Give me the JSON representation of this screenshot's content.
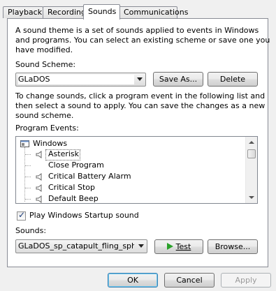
{
  "tabs": [
    {
      "label": "Playback"
    },
    {
      "label": "Recording"
    },
    {
      "label": "Sounds",
      "active": true
    },
    {
      "label": "Communications"
    }
  ],
  "intro_text": [
    "A sound theme is a set of sounds applied to events in Windows",
    "and programs.  You can select an existing scheme or save one you",
    "have modified."
  ],
  "scheme": {
    "label": "Sound Scheme:",
    "value": "GLaDOS",
    "save_as_label": "Save As...",
    "delete_label": "Delete"
  },
  "change_text": [
    "To change sounds, click a program event in the following list and",
    "then select a sound to apply.  You can save the changes as a new",
    "sound scheme."
  ],
  "events": {
    "label": "Program Events:",
    "group": "Windows",
    "items": [
      {
        "label": "Asterisk",
        "selected": true
      },
      {
        "label": "Close Program"
      },
      {
        "label": "Critical Battery Alarm"
      },
      {
        "label": "Critical Stop"
      },
      {
        "label": "Default Beep"
      }
    ]
  },
  "startup": {
    "label": "Play Windows Startup sound",
    "checked": true
  },
  "sounds": {
    "label": "Sounds:",
    "value": "GLaDOS_sp_catapult_fling_sphe",
    "test_label": "Test",
    "browse_label": "Browse..."
  },
  "footer": {
    "ok_label": "OK",
    "cancel_label": "Cancel",
    "apply_label": "Apply"
  },
  "colors": {
    "play_icon": "#2aa12a",
    "panel_border": "#898c95"
  }
}
